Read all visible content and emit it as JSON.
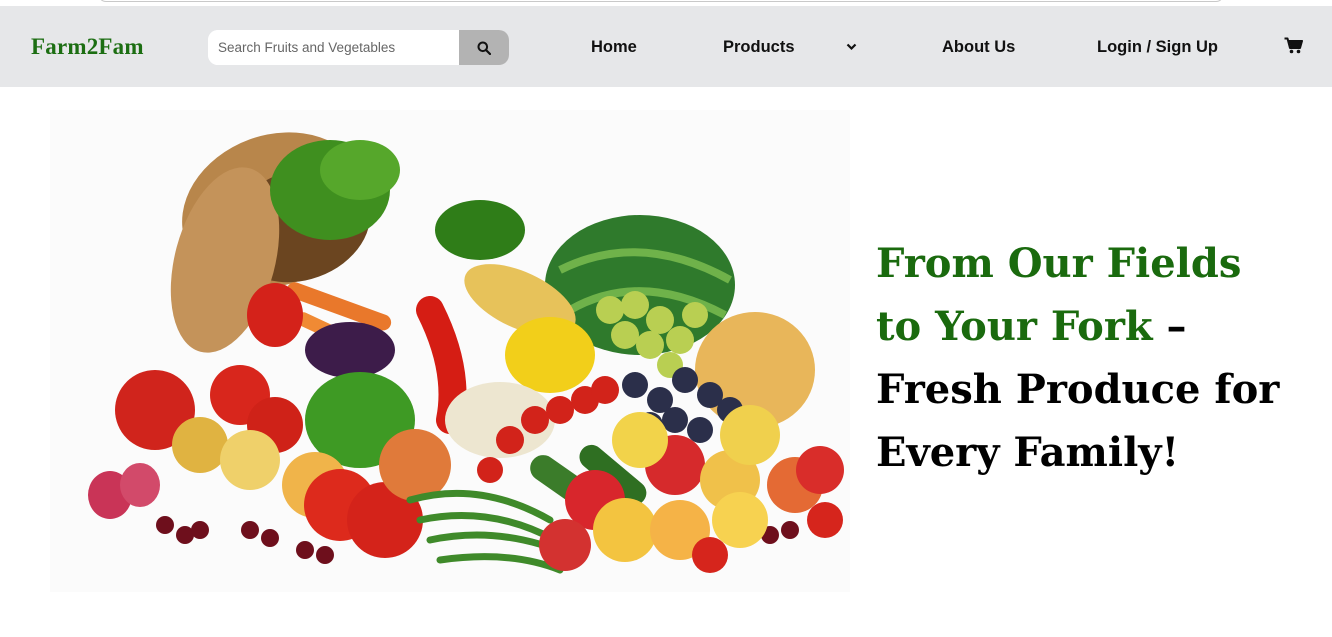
{
  "brand": {
    "name": "Farm2Fam"
  },
  "search": {
    "placeholder": "Search Fruits and Vegetables",
    "value": "",
    "icon": "search-icon"
  },
  "nav": {
    "home": "Home",
    "products": "Products",
    "about": "About Us",
    "login": "Login / Sign Up",
    "cart_icon": "cart-icon",
    "dropdown_icon": "chevron-down-icon"
  },
  "hero": {
    "headline_green": "From Our Fields to Your Fork",
    "headline_black": " – Fresh Produce for Every Family!",
    "image": "fruit-vegetable-basket"
  },
  "colors": {
    "brand_green": "#1c6e12",
    "navbar_bg": "#e6e7e9",
    "search_button_bg": "#b3b3b3"
  }
}
